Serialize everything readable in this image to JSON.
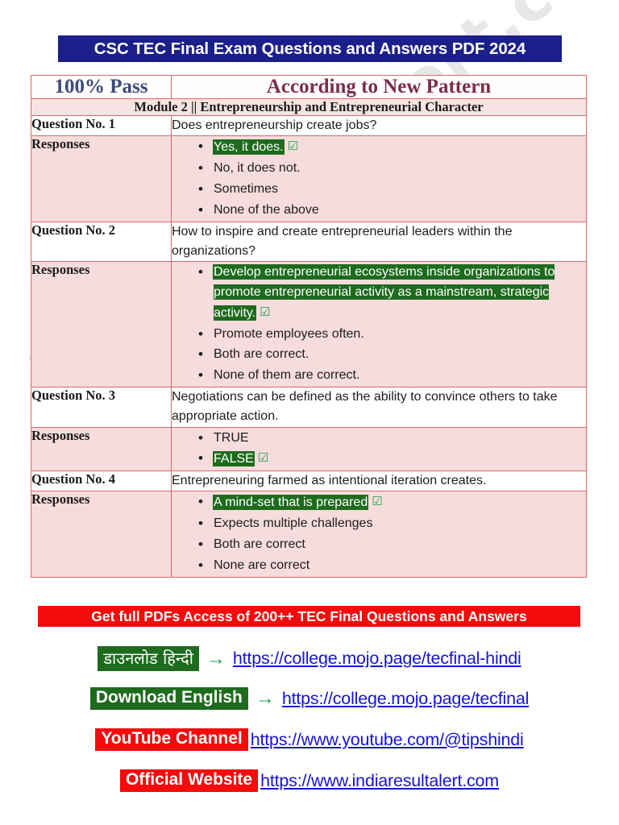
{
  "document": {
    "title": "CSC TEC Final Exam Questions and Answers PDF 2024",
    "watermark": "indiaresultalert.com"
  },
  "colors": {
    "title_banner_bg": "#1b1f8a",
    "promo_banner_bg": "#f40b0b",
    "correct_answer_bg": "#1e6b1e",
    "table_border": "#e06666",
    "response_row_bg": "#f6dcdc",
    "module_row_bg": "#f7e3e3",
    "pass_badge_color": "#3d4a7a",
    "pattern_badge_color": "#7b2d4e",
    "link_color": "#1414d6",
    "arrow_color": "#1e9e4a"
  },
  "table": {
    "badges": {
      "pass": "100% Pass",
      "pattern": "According to New Pattern"
    },
    "module_heading": "Module 2 || Entrepreneurship and Entrepreneurial Character",
    "label_question": "Question No.",
    "label_responses": "Responses",
    "check_icon": "☑",
    "questions": [
      {
        "number": "1",
        "question_label": "Question No. 1",
        "question_text": "Does entrepreneurship create jobs?",
        "responses_label": "Responses",
        "options": [
          {
            "text": "Yes, it does.",
            "correct": true
          },
          {
            "text": "No, it does not.",
            "correct": false
          },
          {
            "text": "Sometimes",
            "correct": false
          },
          {
            "text": "None of the above",
            "correct": false
          }
        ]
      },
      {
        "number": "2",
        "question_label": "Question No. 2",
        "question_text": "How to inspire and create entrepreneurial leaders within the organizations?",
        "responses_label": "Responses",
        "options": [
          {
            "text": "Develop entrepreneurial ecosystems inside organizations to promote entrepreneurial activity as a mainstream, strategic activity.",
            "correct": true
          },
          {
            "text": "Promote employees often.",
            "correct": false
          },
          {
            "text": "Both are correct.",
            "correct": false
          },
          {
            "text": "None of them are correct.",
            "correct": false
          }
        ]
      },
      {
        "number": "3",
        "question_label": "Question No. 3",
        "question_text": "Negotiations can be defined as the ability to convince others to take appropriate action.",
        "responses_label": "Responses",
        "options": [
          {
            "text": "TRUE",
            "correct": false
          },
          {
            "text": "FALSE",
            "correct": true
          }
        ]
      },
      {
        "number": "4",
        "question_label": "Question No. 4",
        "question_text": "Entrepreneuring farmed as intentional iteration creates.",
        "responses_label": "Responses",
        "options": [
          {
            "text": "A mind-set that is prepared",
            "correct": true
          },
          {
            "text": "Expects multiple challenges",
            "correct": false
          },
          {
            "text": "Both are correct",
            "correct": false
          },
          {
            "text": "None are correct",
            "correct": false
          }
        ]
      }
    ]
  },
  "footer": {
    "promo_banner": "Get full PDFs Access of 200++ TEC Final Questions and Answers",
    "arrow_icon": "→",
    "links": [
      {
        "tag": "डाउनलोड  हिन्दी",
        "tag_style": "green",
        "tag_script": "devanagari",
        "show_arrow": true,
        "url": "https://college.mojo.page/tecfinal-hindi"
      },
      {
        "tag": "Download English",
        "tag_style": "green",
        "tag_script": "latin",
        "show_arrow": true,
        "url": "https://college.mojo.page/tecfinal"
      },
      {
        "tag": "YouTube Channel",
        "tag_style": "red",
        "tag_script": "latin",
        "show_arrow": false,
        "url": "https://www.youtube.com/@tipshindi"
      },
      {
        "tag": "Official Website",
        "tag_style": "red",
        "tag_script": "latin",
        "show_arrow": false,
        "url": "https://www.indiaresultalert.com"
      }
    ]
  }
}
